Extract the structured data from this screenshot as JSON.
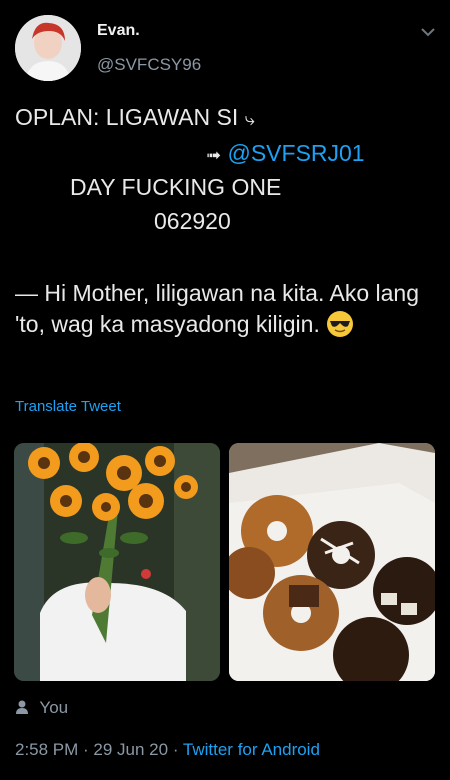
{
  "user": {
    "display_name": "Evan.",
    "handle": "@SVFCSY96"
  },
  "tweet": {
    "line1": "OPLAN: LIGAWAN SI ",
    "arrow1": "⤷",
    "arrow2": "➟",
    "mention": "@SVFSRJ01",
    "line3": "DAY FUCKING ONE",
    "line4": "062920",
    "body": "— Hi Mother, liligawan na kita. Ako lang 'to, wag ka masyadong kiligin.",
    "emoji": "sunglasses-face"
  },
  "translate_label": "Translate Tweet",
  "media": {
    "image1": "boy holding sunflower bouquet",
    "image2": "box of chocolate donuts"
  },
  "reply_by": "You",
  "timestamp": "2:58 PM · 29 Jun 20 · ",
  "client": "Twitter for Android"
}
